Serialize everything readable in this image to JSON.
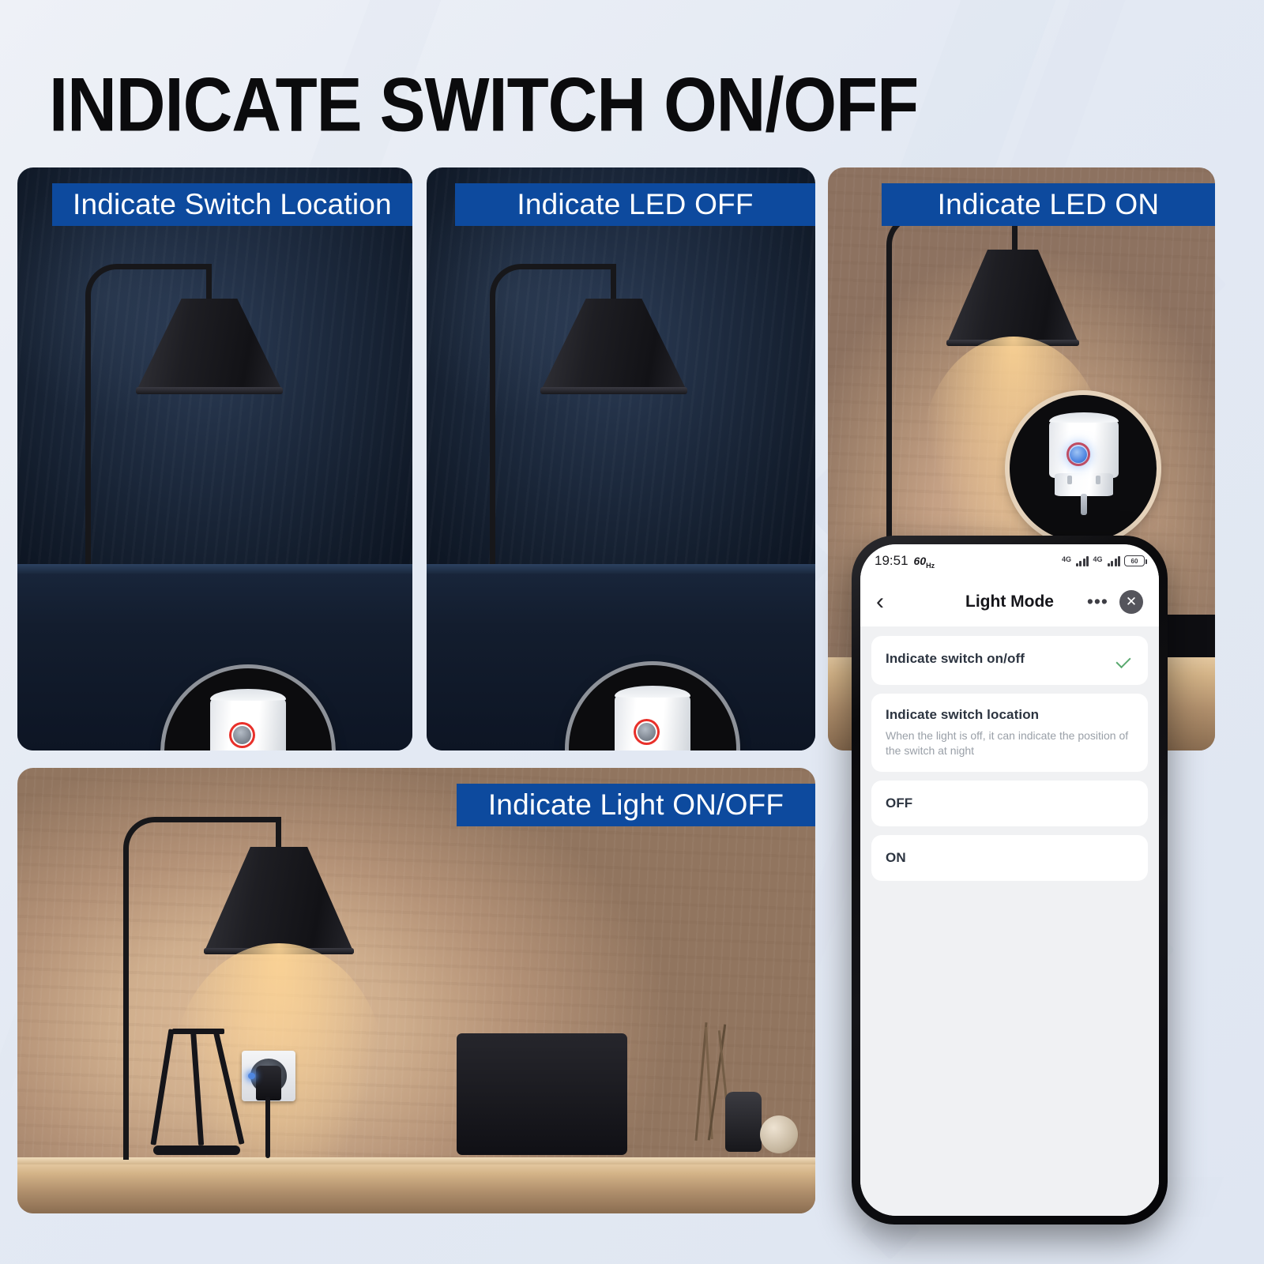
{
  "page": {
    "title": "INDICATE SWITCH ON/OFF",
    "background_color": "#e4e9f2",
    "accent_color": "#0d4a9e"
  },
  "panels": [
    {
      "id": "indicate-switch-location",
      "label": "Indicate Switch Location",
      "scene": "dark-room",
      "led_state": "off-grey",
      "magnifier_ring_color": "#8e9299"
    },
    {
      "id": "indicate-led-off",
      "label": "Indicate LED OFF",
      "scene": "dark-room",
      "led_state": "off-grey",
      "magnifier_ring_color": "#8e9299"
    },
    {
      "id": "indicate-led-on",
      "label": "Indicate LED ON",
      "scene": "warm-room",
      "led_state": "on-blue",
      "magnifier_ring_color": "#e6d3bb"
    },
    {
      "id": "indicate-light-on-off",
      "label": "Indicate Light ON/OFF",
      "scene": "warm-room",
      "led_state": "on-blue",
      "magnifier_ring_color": "none"
    }
  ],
  "phone": {
    "status_bar": {
      "time": "19:51",
      "refresh_rate": "60",
      "refresh_rate_unit": "Hz",
      "network_1": "4G",
      "network_2": "4G",
      "battery": "60"
    },
    "app_header": {
      "back_icon": "chevron-left-icon",
      "title": "Light Mode",
      "more_icon": "ellipsis-icon",
      "close_icon": "close-icon"
    },
    "options": [
      {
        "title": "Indicate switch on/off",
        "description": "",
        "selected": true
      },
      {
        "title": "Indicate switch location",
        "description": "When the light is off, it can indicate the position of the switch at night",
        "selected": false
      },
      {
        "title": "OFF",
        "description": "",
        "selected": false
      },
      {
        "title": "ON",
        "description": "",
        "selected": false
      }
    ]
  }
}
